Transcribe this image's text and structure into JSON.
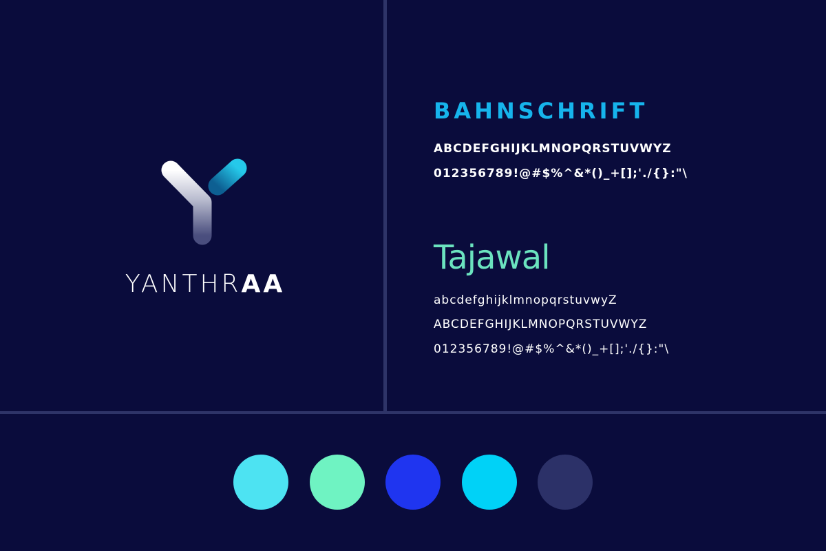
{
  "brand": {
    "wordmark_light": "YANTHR",
    "wordmark_bold": "AA",
    "logo_icon": "y-letter-logo-icon"
  },
  "typography": {
    "primary": {
      "name": "BAHNSCHRIFT",
      "uppercase": "ABCDEFGHIJKLMNOPQRSTUVWYZ",
      "digits_symbols": "012356789!@#$%^&*()_+[];'./{}:\"\\",
      "color": "#16b4ec"
    },
    "secondary": {
      "name": "Tajawal",
      "lowercase": "abcdefghijklmnopqrstuvwyZ",
      "uppercase": "ABCDEFGHIJKLMNOPQRSTUVWYZ",
      "digits_symbols": "012356789!@#$%^&*()_+[];'./{}:\"\\",
      "color": "#6be3bf"
    }
  },
  "palette": {
    "colors": [
      "#4de3f2",
      "#6ff3c2",
      "#1f35f0",
      "#00d2f7",
      "#2c3168"
    ]
  },
  "theme": {
    "background": "#0a0c3c",
    "divider": "#2e3468"
  }
}
